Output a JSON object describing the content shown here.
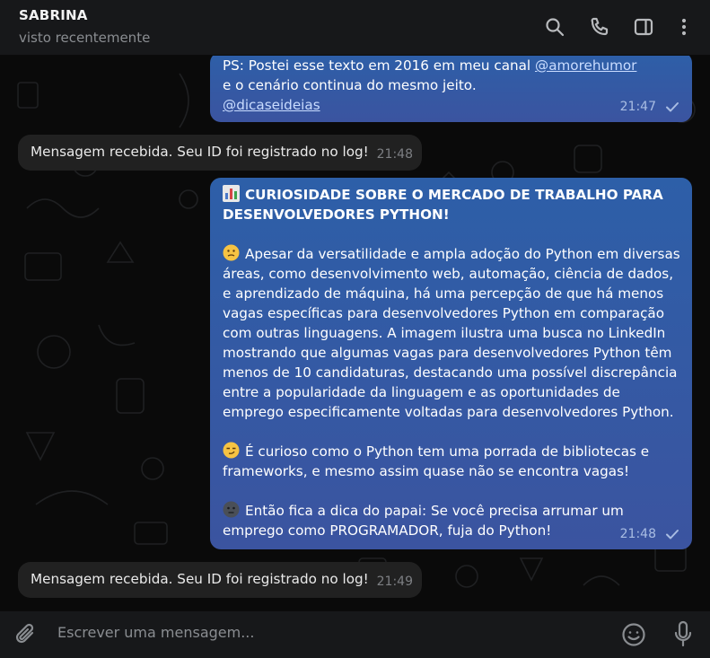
{
  "header": {
    "contact_name": "SABRINA",
    "status": "visto recentemente",
    "icons": [
      "search-icon",
      "phone-icon",
      "sidebar-toggle-icon",
      "more-vertical-icon"
    ]
  },
  "messages": [
    {
      "direction": "out",
      "lines_before": "PS: Postei esse texto em 2016 em meu canal ",
      "link1": "@amorehumor",
      "lines_mid": " e o cenário continua do mesmo jeito.",
      "link2": "@dicaseideias",
      "time": "21:47",
      "status": "sent"
    },
    {
      "direction": "in",
      "text": "Mensagem recebida. Seu ID foi registrado no log!",
      "time": "21:48"
    },
    {
      "direction": "out",
      "title": "CURIOSIDADE SOBRE O MERCADO DE TRABALHO PARA DESENVOLVEDORES PYTHON!",
      "para1": "Apesar da versatilidade e ampla adoção do Python em diversas áreas, como desenvolvimento web, automação, ciência de dados, e aprendizado de máquina, há uma percepção de que há menos vagas específicas para desenvolvedores Python em comparação com outras linguagens. A imagem ilustra uma busca no LinkedIn mostrando que algumas vagas para desenvolvedores Python têm menos de 10 candidaturas, destacando uma possível discrepância entre a popularidade da linguagem e as oportunidades de emprego especificamente voltadas para desenvolvedores Python.",
      "para2": "É curioso como o Python tem uma porrada de bibliotecas e frameworks, e mesmo assim quase não se encontra vagas!",
      "para3": "Então fica a dica do papai: Se você precisa arrumar um emprego como PROGRAMADOR, fuja do Python!",
      "time": "21:48",
      "status": "sent"
    },
    {
      "direction": "in",
      "text": "Mensagem recebida. Seu ID foi registrado no log!",
      "time": "21:49"
    }
  ],
  "composer": {
    "placeholder": "Escrever uma mensagem...",
    "icons": [
      "attach-icon",
      "emoji-icon",
      "microphone-icon"
    ]
  },
  "colors": {
    "outgoing_bubble": "#2f5ca6",
    "incoming_bubble": "#212121",
    "header_bg": "#17181a",
    "link": "#c9dcff"
  }
}
